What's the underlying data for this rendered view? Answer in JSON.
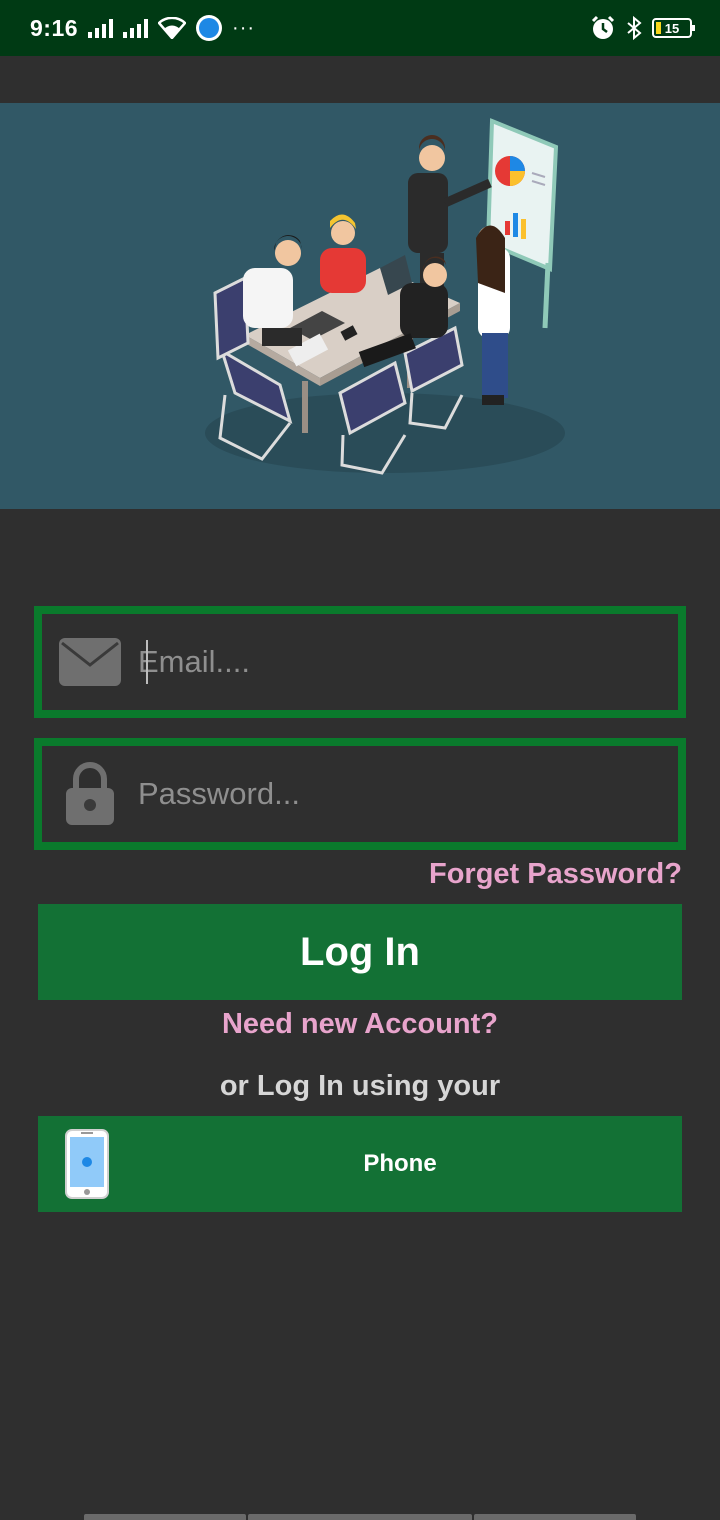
{
  "status_bar": {
    "time": "9:16",
    "battery": "15",
    "icons": [
      "signal-icon",
      "signal-icon",
      "wifi-icon",
      "messenger-icon",
      "more-dots-icon",
      "alarm-icon",
      "bluetooth-icon",
      "battery-icon"
    ],
    "dots": "···"
  },
  "hero": {
    "illustration": "business-meeting-illustration",
    "background_color": "#315866"
  },
  "form": {
    "email_placeholder": "Email....",
    "password_placeholder": "Password...",
    "forgot_label": "Forget Password?",
    "login_label": "Log In",
    "need_account_label": "Need new Account?",
    "or_label": "or Log In using your",
    "phone_label": "Phone"
  },
  "colors": {
    "accent_green": "#137135",
    "field_border": "#0a7a2c",
    "link_pink": "#e8a4cc",
    "background": "#2f2f2f",
    "status_bar": "#003a14"
  }
}
